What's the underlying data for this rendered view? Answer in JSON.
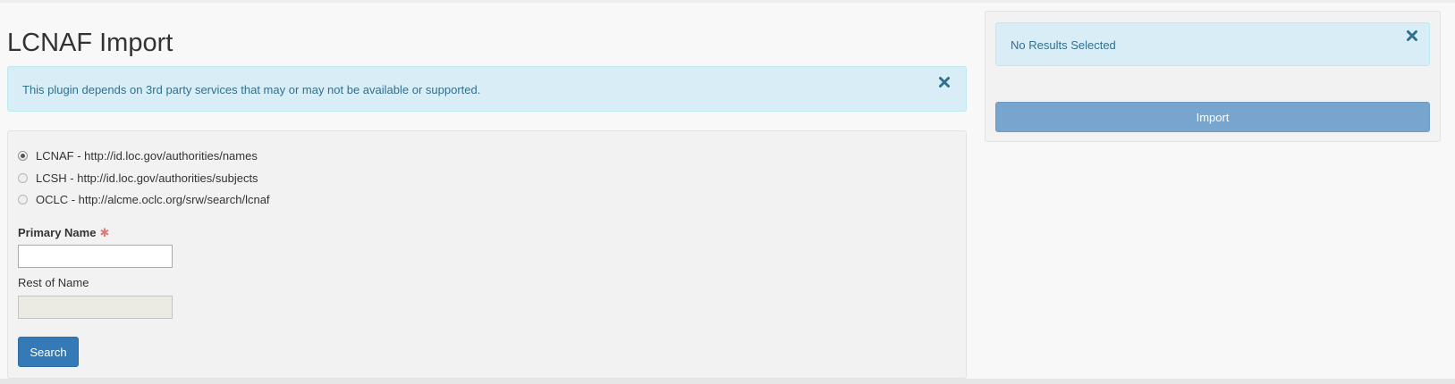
{
  "page": {
    "title": "LCNAF Import"
  },
  "notice": {
    "text": "This plugin depends on 3rd party services that may or may not be available or supported.",
    "close_icon": "close-x-icon"
  },
  "source_options": [
    {
      "label": "LCNAF - http://id.loc.gov/authorities/names",
      "selected": true
    },
    {
      "label": "LCSH - http://id.loc.gov/authorities/subjects",
      "selected": false
    },
    {
      "label": "OCLC - http://alcme.oclc.org/srw/search/lcnaf",
      "selected": false
    }
  ],
  "form": {
    "primary_name_label": "Primary Name",
    "required_marker": "✱",
    "primary_name_value": "",
    "rest_of_name_label": "Rest of Name",
    "rest_of_name_value": "",
    "search_label": "Search"
  },
  "results": {
    "status_text": "No Results Selected",
    "close_icon": "close-x-icon",
    "import_label": "Import"
  },
  "colors": {
    "alert_bg": "#d9edf7",
    "alert_text": "#31708f",
    "primary_button": "#337ab7",
    "import_button": "#77a5ce",
    "required_star": "#e07b7b"
  }
}
